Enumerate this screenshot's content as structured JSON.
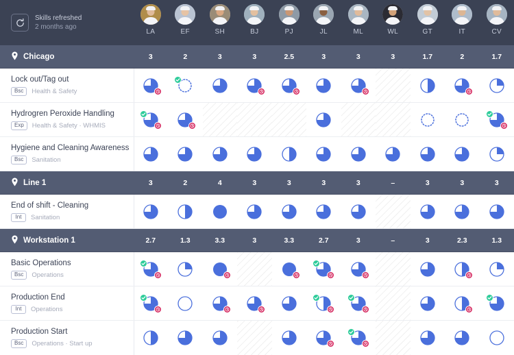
{
  "header": {
    "refresh_icon": "refresh-icon",
    "refresh_title": "Skills refreshed",
    "refresh_sub": "2 months ago",
    "people": [
      {
        "initials": "LA"
      },
      {
        "initials": "EF"
      },
      {
        "initials": "SH"
      },
      {
        "initials": "BJ"
      },
      {
        "initials": "PJ"
      },
      {
        "initials": "JL"
      },
      {
        "initials": "ML"
      },
      {
        "initials": "WL"
      },
      {
        "initials": "GT"
      },
      {
        "initials": "IT"
      },
      {
        "initials": "CV"
      }
    ]
  },
  "colors": {
    "header_bg": "#3b4254",
    "group_bg": "#535c73",
    "pie_fill": "#4a6fdc",
    "check_badge": "#2ecc9a",
    "clock_badge": "#d4245c",
    "row_border": "#eceef2"
  },
  "groups": [
    {
      "name": "Chicago",
      "icon": "location-pin-icon",
      "values": [
        "3",
        "2",
        "3",
        "3",
        "2.5",
        "3",
        "3",
        "3",
        "1.7",
        "2",
        "1.7"
      ],
      "rows": [
        {
          "title": "Lock out/Tag out",
          "level": "Bsc",
          "category": "Health & Safety",
          "cells": [
            {
              "pct": 75,
              "check": false,
              "clock": true,
              "hatch": false,
              "empty": false
            },
            {
              "pct": 0,
              "check": true,
              "clock": false,
              "hatch": false,
              "empty": true
            },
            {
              "pct": 75,
              "check": false,
              "clock": false,
              "hatch": false,
              "empty": false
            },
            {
              "pct": 75,
              "check": false,
              "clock": true,
              "hatch": false,
              "empty": false
            },
            {
              "pct": 75,
              "check": false,
              "clock": true,
              "hatch": false,
              "empty": false
            },
            {
              "pct": 75,
              "check": false,
              "clock": false,
              "hatch": false,
              "empty": false
            },
            {
              "pct": 75,
              "check": false,
              "clock": true,
              "hatch": false,
              "empty": false
            },
            {
              "pct": 0,
              "check": false,
              "clock": false,
              "hatch": true,
              "empty": true
            },
            {
              "pct": 50,
              "check": false,
              "clock": false,
              "hatch": false,
              "empty": false
            },
            {
              "pct": 75,
              "check": false,
              "clock": true,
              "hatch": false,
              "empty": false
            },
            {
              "pct": 25,
              "check": false,
              "clock": false,
              "hatch": false,
              "empty": false
            }
          ]
        },
        {
          "title": "Hydrogren Peroxide Handling",
          "level": "Exp",
          "category": "Health & Safety · WHMIS",
          "cells": [
            {
              "pct": 75,
              "check": true,
              "clock": true,
              "hatch": false,
              "empty": false
            },
            {
              "pct": 75,
              "check": false,
              "clock": true,
              "hatch": false,
              "empty": false
            },
            {
              "pct": 0,
              "check": false,
              "clock": false,
              "hatch": true,
              "empty": true
            },
            {
              "pct": 0,
              "check": false,
              "clock": false,
              "hatch": true,
              "empty": true
            },
            {
              "pct": 0,
              "check": false,
              "clock": false,
              "hatch": true,
              "empty": true
            },
            {
              "pct": 75,
              "check": false,
              "clock": false,
              "hatch": false,
              "empty": false
            },
            {
              "pct": 0,
              "check": false,
              "clock": false,
              "hatch": true,
              "empty": true
            },
            {
              "pct": 0,
              "check": false,
              "clock": false,
              "hatch": true,
              "empty": true
            },
            {
              "pct": 0,
              "check": false,
              "clock": false,
              "hatch": false,
              "empty": true
            },
            {
              "pct": 0,
              "check": false,
              "clock": false,
              "hatch": false,
              "empty": true
            },
            {
              "pct": 75,
              "check": true,
              "clock": true,
              "hatch": false,
              "empty": false
            }
          ]
        },
        {
          "title": "Hygiene and Cleaning Awareness",
          "level": "Bsc",
          "category": "Sanitation",
          "cells": [
            {
              "pct": 75,
              "check": false,
              "clock": false,
              "hatch": false,
              "empty": false
            },
            {
              "pct": 75,
              "check": false,
              "clock": false,
              "hatch": false,
              "empty": false
            },
            {
              "pct": 75,
              "check": false,
              "clock": false,
              "hatch": false,
              "empty": false
            },
            {
              "pct": 75,
              "check": false,
              "clock": false,
              "hatch": false,
              "empty": false
            },
            {
              "pct": 50,
              "check": false,
              "clock": false,
              "hatch": false,
              "empty": false
            },
            {
              "pct": 75,
              "check": false,
              "clock": false,
              "hatch": false,
              "empty": false
            },
            {
              "pct": 75,
              "check": false,
              "clock": false,
              "hatch": false,
              "empty": false
            },
            {
              "pct": 75,
              "check": false,
              "clock": false,
              "hatch": false,
              "empty": false
            },
            {
              "pct": 75,
              "check": false,
              "clock": false,
              "hatch": false,
              "empty": false
            },
            {
              "pct": 75,
              "check": false,
              "clock": false,
              "hatch": false,
              "empty": false
            },
            {
              "pct": 25,
              "check": false,
              "clock": false,
              "hatch": false,
              "empty": false
            }
          ]
        }
      ]
    },
    {
      "name": "Line 1",
      "icon": "location-pin-icon",
      "values": [
        "3",
        "2",
        "4",
        "3",
        "3",
        "3",
        "3",
        "–",
        "3",
        "3",
        "3"
      ],
      "rows": [
        {
          "title": "End of shift - Cleaning",
          "level": "Int",
          "category": "Sanitation",
          "cells": [
            {
              "pct": 75,
              "check": false,
              "clock": false,
              "hatch": false,
              "empty": false
            },
            {
              "pct": 50,
              "check": false,
              "clock": false,
              "hatch": false,
              "empty": false
            },
            {
              "pct": 100,
              "check": false,
              "clock": false,
              "hatch": false,
              "empty": false
            },
            {
              "pct": 75,
              "check": false,
              "clock": false,
              "hatch": false,
              "empty": false
            },
            {
              "pct": 75,
              "check": false,
              "clock": false,
              "hatch": false,
              "empty": false
            },
            {
              "pct": 75,
              "check": false,
              "clock": false,
              "hatch": false,
              "empty": false
            },
            {
              "pct": 75,
              "check": false,
              "clock": false,
              "hatch": false,
              "empty": false
            },
            {
              "pct": 0,
              "check": false,
              "clock": false,
              "hatch": true,
              "empty": true
            },
            {
              "pct": 75,
              "check": false,
              "clock": false,
              "hatch": false,
              "empty": false
            },
            {
              "pct": 75,
              "check": false,
              "clock": false,
              "hatch": false,
              "empty": false
            },
            {
              "pct": 75,
              "check": false,
              "clock": false,
              "hatch": false,
              "empty": false
            }
          ]
        }
      ]
    },
    {
      "name": "Workstation 1",
      "icon": "location-pin-icon",
      "values": [
        "2.7",
        "1.3",
        "3.3",
        "3",
        "3.3",
        "2.7",
        "3",
        "–",
        "3",
        "2.3",
        "1.3"
      ],
      "rows": [
        {
          "title": "Basic Operations",
          "level": "Bsc",
          "category": "Operations",
          "cells": [
            {
              "pct": 75,
              "check": true,
              "clock": true,
              "hatch": false,
              "empty": false
            },
            {
              "pct": 25,
              "check": false,
              "clock": false,
              "hatch": false,
              "empty": false
            },
            {
              "pct": 100,
              "check": false,
              "clock": true,
              "hatch": false,
              "empty": false
            },
            {
              "pct": 0,
              "check": false,
              "clock": false,
              "hatch": true,
              "empty": true
            },
            {
              "pct": 100,
              "check": false,
              "clock": true,
              "hatch": false,
              "empty": false
            },
            {
              "pct": 75,
              "check": true,
              "clock": true,
              "hatch": false,
              "empty": false
            },
            {
              "pct": 75,
              "check": false,
              "clock": true,
              "hatch": false,
              "empty": false
            },
            {
              "pct": 0,
              "check": false,
              "clock": false,
              "hatch": true,
              "empty": true
            },
            {
              "pct": 75,
              "check": false,
              "clock": false,
              "hatch": false,
              "empty": false
            },
            {
              "pct": 50,
              "check": false,
              "clock": true,
              "hatch": false,
              "empty": false
            },
            {
              "pct": 25,
              "check": false,
              "clock": false,
              "hatch": false,
              "empty": false
            }
          ]
        },
        {
          "title": "Production End",
          "level": "Int",
          "category": "Operations",
          "cells": [
            {
              "pct": 75,
              "check": true,
              "clock": true,
              "hatch": false,
              "empty": false
            },
            {
              "pct": 0,
              "check": false,
              "clock": false,
              "hatch": false,
              "empty": true
            },
            {
              "pct": 75,
              "check": false,
              "clock": true,
              "hatch": false,
              "empty": false
            },
            {
              "pct": 75,
              "check": false,
              "clock": true,
              "hatch": false,
              "empty": false
            },
            {
              "pct": 75,
              "check": false,
              "clock": false,
              "hatch": false,
              "empty": false
            },
            {
              "pct": 50,
              "check": true,
              "clock": true,
              "hatch": false,
              "empty": false
            },
            {
              "pct": 75,
              "check": true,
              "clock": true,
              "hatch": false,
              "empty": false
            },
            {
              "pct": 0,
              "check": false,
              "clock": false,
              "hatch": true,
              "empty": true
            },
            {
              "pct": 75,
              "check": false,
              "clock": false,
              "hatch": false,
              "empty": false
            },
            {
              "pct": 50,
              "check": false,
              "clock": true,
              "hatch": false,
              "empty": false
            },
            {
              "pct": 75,
              "check": true,
              "clock": false,
              "hatch": false,
              "empty": false
            }
          ]
        },
        {
          "title": "Production Start",
          "level": "Bsc",
          "category": "Operations · Start up",
          "cells": [
            {
              "pct": 50,
              "check": false,
              "clock": false,
              "hatch": false,
              "empty": false
            },
            {
              "pct": 75,
              "check": false,
              "clock": false,
              "hatch": false,
              "empty": false
            },
            {
              "pct": 75,
              "check": false,
              "clock": false,
              "hatch": false,
              "empty": false
            },
            {
              "pct": 0,
              "check": false,
              "clock": false,
              "hatch": true,
              "empty": true
            },
            {
              "pct": 75,
              "check": false,
              "clock": false,
              "hatch": false,
              "empty": false
            },
            {
              "pct": 75,
              "check": false,
              "clock": true,
              "hatch": false,
              "empty": false
            },
            {
              "pct": 75,
              "check": true,
              "clock": true,
              "hatch": false,
              "empty": false
            },
            {
              "pct": 0,
              "check": false,
              "clock": false,
              "hatch": true,
              "empty": true
            },
            {
              "pct": 75,
              "check": false,
              "clock": false,
              "hatch": false,
              "empty": false
            },
            {
              "pct": 75,
              "check": false,
              "clock": false,
              "hatch": false,
              "empty": false
            },
            {
              "pct": 0,
              "check": false,
              "clock": false,
              "hatch": false,
              "empty": true
            }
          ]
        }
      ]
    }
  ]
}
